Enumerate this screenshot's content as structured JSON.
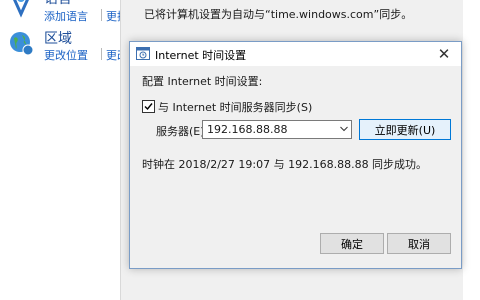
{
  "control_panel": {
    "language": {
      "title": "语言",
      "links": [
        "添加语言",
        "更换"
      ]
    },
    "region": {
      "title": "区域",
      "links": [
        "更改位置",
        "更改"
      ]
    }
  },
  "background_dialog": {
    "message": "已将计算机设置为自动与“time.windows.com”同步。"
  },
  "dialog": {
    "title": "Internet 时间设置",
    "close_label": "✕",
    "config_label": "配置 Internet 时间设置:",
    "sync_checkbox_label": "与 Internet 时间服务器同步(S)",
    "sync_checked": true,
    "server_label": "服务器(E):",
    "server_value": "192.168.88.88",
    "update_button": "立即更新(U)",
    "status_text": "时钟在 2018/2/27 19:07 与 192.168.88.88 同步成功。",
    "ok_button": "确定",
    "cancel_button": "取消"
  },
  "colors": {
    "link": "#1b62c5",
    "title_link": "#1e4e99",
    "accent": "#0078d7"
  }
}
